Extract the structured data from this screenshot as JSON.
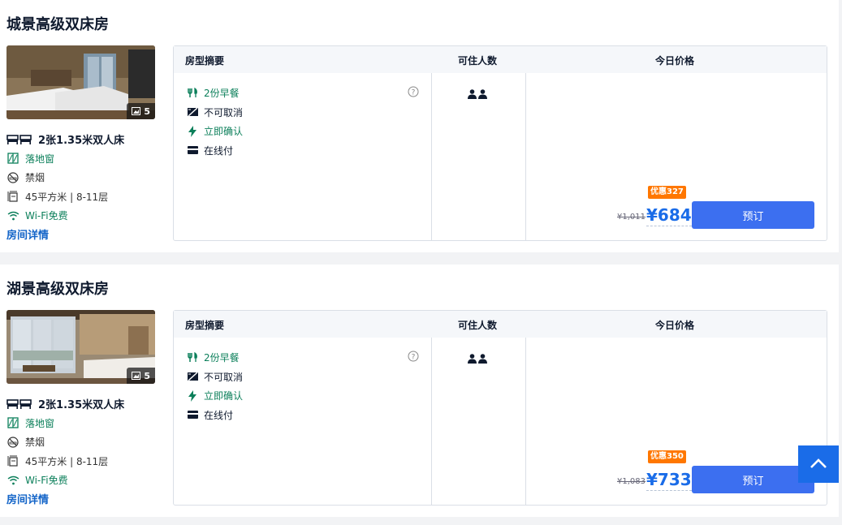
{
  "table_header": {
    "summary": "房型摘要",
    "guests": "可住人数",
    "price": "今日价格"
  },
  "rooms": [
    {
      "title": "城景高级双床房",
      "photo_count": "5",
      "bed": "2张1.35米双人床",
      "window": "落地窗",
      "smoking": "禁烟",
      "area_floor": "45平方米 | 8-11层",
      "wifi": "Wi-Fi免费",
      "detail_link": "房间详情",
      "breakfast": "2份早餐",
      "cancel": "不可取消",
      "confirm": "立即确认",
      "payment": "在线付",
      "guests": 2,
      "discount": "优惠327",
      "original_price": "¥1,011",
      "price": "¥684",
      "book_label": "预订"
    },
    {
      "title": "湖景高级双床房",
      "photo_count": "5",
      "bed": "2张1.35米双人床",
      "window": "落地窗",
      "smoking": "禁烟",
      "area_floor": "45平方米 | 8-11层",
      "wifi": "Wi-Fi免费",
      "detail_link": "房间详情",
      "breakfast": "2份早餐",
      "cancel": "不可取消",
      "confirm": "立即确认",
      "payment": "在线付",
      "guests": 2,
      "discount": "优惠350",
      "original_price": "¥1,083",
      "price": "¥733",
      "book_label": "预订"
    }
  ],
  "colors": {
    "accent": "#3c6ff0",
    "price": "#1a6ce8",
    "discount": "#ff7700",
    "green": "#0b7f5a",
    "link": "#1465c8"
  },
  "icons": [
    "bed-icon",
    "window-icon",
    "no-smoking-icon",
    "floor-icon",
    "wifi-icon",
    "breakfast-icon",
    "no-cancel-icon",
    "instant-confirm-icon",
    "payment-card-icon",
    "help-icon",
    "person-icon",
    "image-icon",
    "chevron-up-icon"
  ]
}
